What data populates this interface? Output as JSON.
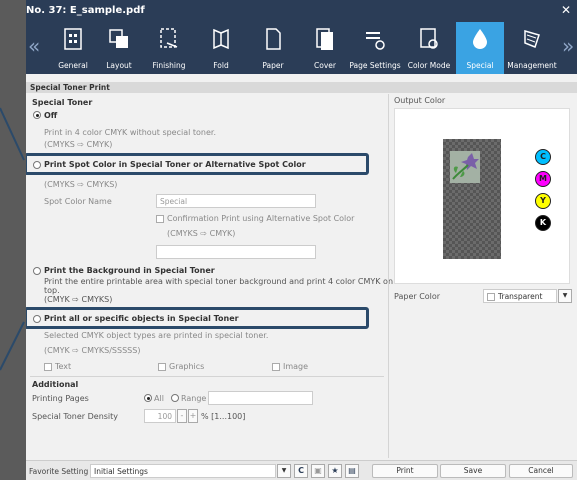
{
  "window": {
    "title": "No. 37: E_sample.pdf",
    "close_glyph": "✕"
  },
  "toolbar": {
    "prev_glyph": "«",
    "next_glyph": "»",
    "tabs": [
      {
        "label": "General",
        "icon": "general-icon"
      },
      {
        "label": "Layout",
        "icon": "layout-icon"
      },
      {
        "label": "Finishing",
        "icon": "finishing-icon"
      },
      {
        "label": "Fold",
        "icon": "fold-icon"
      },
      {
        "label": "Paper",
        "icon": "paper-icon"
      },
      {
        "label": "Cover",
        "icon": "cover-icon"
      },
      {
        "label": "Page Settings",
        "icon": "page-settings-icon"
      },
      {
        "label": "Color Mode",
        "icon": "color-mode-icon"
      },
      {
        "label": "Special",
        "icon": "special-icon",
        "active": true
      },
      {
        "label": "Management",
        "icon": "management-icon"
      }
    ]
  },
  "section_title": "Special Toner Print",
  "special_toner": {
    "group_label": "Special Toner",
    "off_label": "Off",
    "off_desc": "Print in 4 color CMYK without special toner.",
    "off_conv": "(CMYKS ⇨ CMYK)",
    "spot_label": "Print Spot Color in Special Toner or Alternative Spot Color",
    "spot_conv": "(CMYKS ⇨ CMYKS)",
    "spot_name_label": "Spot Color Name",
    "spot_name_value": "Special",
    "confirm_label": "Confirmation Print using Alternative Spot Color",
    "confirm_conv": "(CMYKS ⇨ CMYK)",
    "bg_label": "Print the Background in Special Toner",
    "bg_desc_1": "Print the entire printable area with special toner background and print 4 color CMYK on",
    "bg_desc_2": "top.",
    "bg_conv": "(CMYK ⇨ CMYKS)",
    "objects_label": "Print all or specific objects in Special Toner",
    "objects_desc": "Selected CMYK object types are printed in special toner.",
    "objects_conv": "(CMYK ⇨ CMYKS/SSSSS)",
    "obj_text": "Text",
    "obj_graphics": "Graphics",
    "obj_image": "Image"
  },
  "additional": {
    "group_label": "Additional",
    "printing_pages_label": "Printing Pages",
    "all_label": "All",
    "range_label": "Range",
    "density_label": "Special Toner Density",
    "density_value": "100",
    "minus": "-",
    "plus": "+",
    "density_unit": "% [1...100]"
  },
  "preview": {
    "output_color_label": "Output Color",
    "inks": [
      {
        "letter": "C",
        "color": "#00bfff"
      },
      {
        "letter": "M",
        "color": "#ff00ff"
      },
      {
        "letter": "Y",
        "color": "#ffff00"
      },
      {
        "letter": "K",
        "color": "#000000"
      }
    ],
    "paper_color_label": "Paper Color",
    "paper_color_value": "Transparent",
    "dropdown_glyph": "▼"
  },
  "footer": {
    "favorite_label": "Favorite Setting",
    "favorite_value": "Initial Settings",
    "dropdown_glyph": "▼",
    "print_button": "Print",
    "save_button": "Save",
    "cancel_button": "Cancel"
  },
  "colors": {
    "title_bar": "#2b3d57",
    "active_tab": "#3aa3e3",
    "highlight": "#2b4a6a"
  }
}
